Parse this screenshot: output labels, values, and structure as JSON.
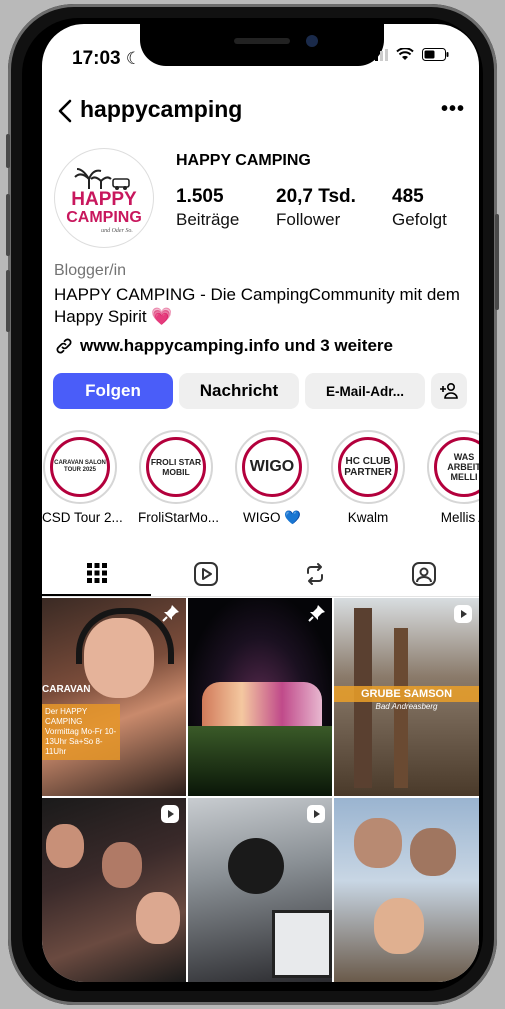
{
  "status": {
    "time": "17:03"
  },
  "header": {
    "username": "happycamping",
    "more": "•••"
  },
  "profile": {
    "avatar_text_1": "HAPPY",
    "avatar_text_2": "CAMPING",
    "avatar_text_3": "und Oder So.",
    "display_name": "HAPPY CAMPING",
    "stats": [
      {
        "value": "1.505",
        "label": "Beiträge"
      },
      {
        "value": "20,7 Tsd.",
        "label": "Follower"
      },
      {
        "value": "485",
        "label": "Gefolgt"
      }
    ],
    "category": "Blogger/in",
    "bio": "HAPPY CAMPING - Die CampingCommunity mit dem Happy Spirit 💗",
    "link": "www.happycamping.info und 3 weitere"
  },
  "actions": {
    "follow": "Folgen",
    "message": "Nachricht",
    "email": "E-Mail-Adr..."
  },
  "highlights": [
    {
      "inner": "CARAVAN SALON TOUR 2025",
      "caption": "CSD Tour 2..."
    },
    {
      "inner": "FROLI STAR MOBIL",
      "caption": "FroliStarMo..."
    },
    {
      "inner": "WIGO",
      "caption": "WIGO 💙"
    },
    {
      "inner": "HC CLUB PARTNER",
      "caption": "Kwalm"
    },
    {
      "inner": "WAS ARBEIT MELLI",
      "caption": "Mellis A"
    }
  ],
  "posts": [
    {
      "overlay_1": "CARAVAN",
      "overlay_2": "Der HAPPY CAMPING Vormittag Mo-Fr 10-13Uhr Sa+So 8-11Uhr"
    },
    {
      "overlay_1": ""
    },
    {
      "overlay_1": "GRUBE SAMSON",
      "overlay_2": "Bad Andreasberg"
    },
    {
      "overlay_1": ""
    },
    {
      "overlay_1": ""
    },
    {
      "overlay_1": ""
    }
  ],
  "colors": {
    "accent": "#4a5df9",
    "brand_pink": "#c8175d",
    "ring": "#b3003c"
  }
}
